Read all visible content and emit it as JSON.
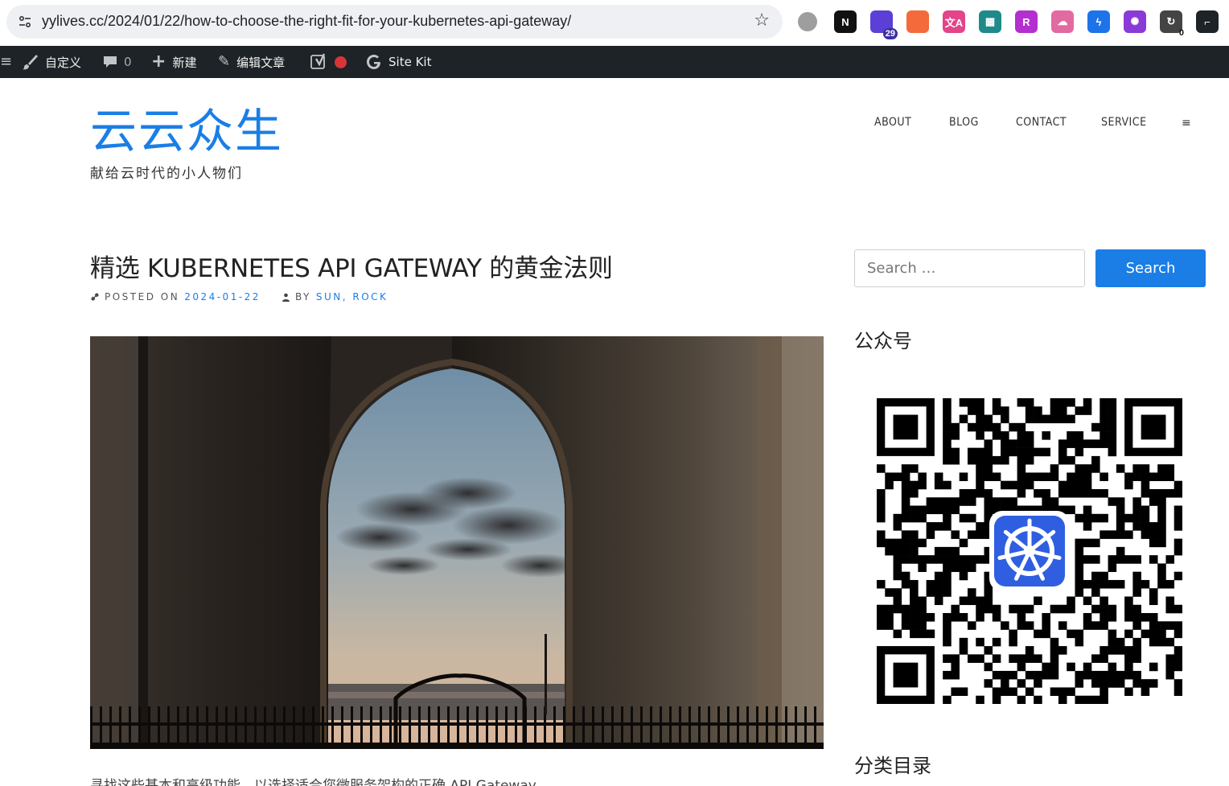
{
  "browser": {
    "url": "yylives.cc/2024/01/22/how-to-choose-the-right-fit-for-your-kubernetes-api-gateway/",
    "extensions": [
      {
        "name": "green-circle-extension-icon",
        "text": "",
        "color": "#9e9e9e"
      },
      {
        "name": "notion-extension-icon",
        "text": "N",
        "color": "#111111"
      },
      {
        "name": "mortarboard-extension-icon",
        "text": "",
        "color": "#5b3fd6",
        "badge": "29"
      },
      {
        "name": "orange-blob-extension-icon",
        "text": "",
        "color": "#f56a3a"
      },
      {
        "name": "translate-extension-icon",
        "text": "文A",
        "color": "#e3448a"
      },
      {
        "name": "grid-extension-icon",
        "text": "▦",
        "color": "#1f8a8a"
      },
      {
        "name": "purple-r-extension-icon",
        "text": "R",
        "color": "#b32fd0"
      },
      {
        "name": "cloud-extension-icon",
        "text": "☁",
        "color": "#e26aa0"
      },
      {
        "name": "blue-bolt-extension-icon",
        "text": "ϟ",
        "color": "#1e73e8"
      },
      {
        "name": "openai-extension-icon",
        "text": "✺",
        "color": "#8a3ad6"
      },
      {
        "name": "refresh-extension-icon",
        "text": "↻",
        "color": "#444444",
        "badge0": "0"
      },
      {
        "name": "dark-square-extension-icon",
        "text": "⌐",
        "color": "#1d2327"
      }
    ]
  },
  "admin_bar": {
    "customize": "自定义",
    "comments_count": "0",
    "new": "新建",
    "edit_post": "编辑文章",
    "site_kit": "Site Kit"
  },
  "site": {
    "title": "云云众生",
    "tagline": "献给云时代的小人物们",
    "nav": [
      "ABOUT",
      "BLOG",
      "CONTACT",
      "SERVICE"
    ]
  },
  "post": {
    "title": "精选 KUBERNETES API GATEWAY 的黄金法则",
    "posted_on_label": "POSTED ON",
    "date": "2024-01-22",
    "by_label": "BY",
    "author": "SUN, ROCK",
    "excerpt": "寻找这些基本和高级功能，以选择适合您微服务架构的正确 API Gateway。"
  },
  "sidebar": {
    "search_placeholder": "Search …",
    "search_button": "Search",
    "wechat_title": "公众号",
    "categories_title": "分类目录"
  },
  "colors": {
    "accent": "#1a7ee6",
    "admin_bar": "#1d2327"
  }
}
